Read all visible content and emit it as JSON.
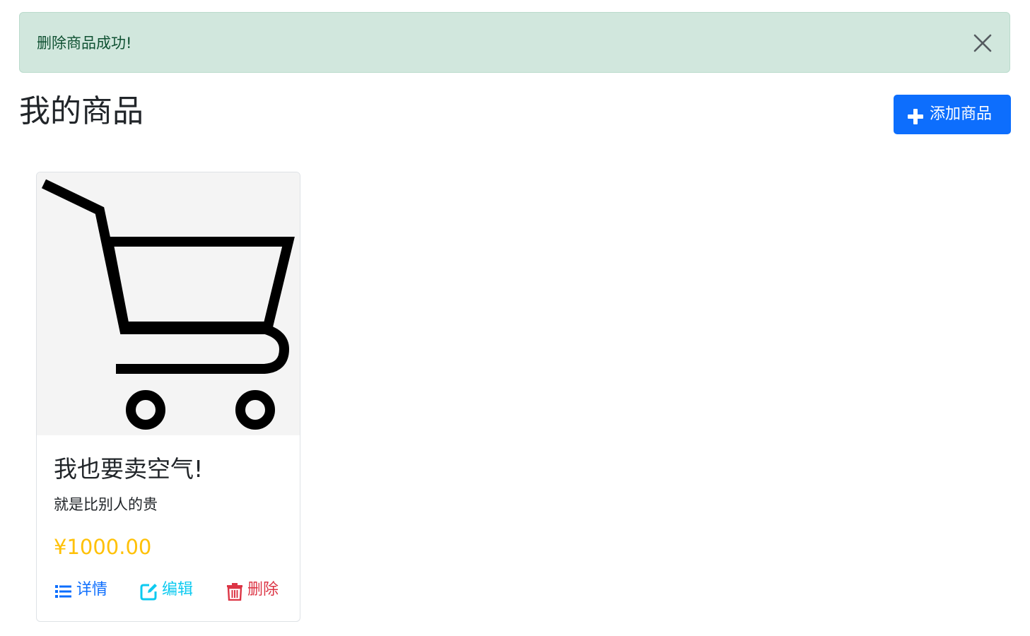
{
  "alert": {
    "message": "删除商品成功!",
    "close_icon": "close-icon",
    "color": "#d1e7dd"
  },
  "header": {
    "title": "我的商品",
    "add_button_label": "添加商品",
    "add_button_icon": "plus-icon",
    "accent_color": "#0d6efd"
  },
  "products": [
    {
      "image_icon": "shopping-cart-icon",
      "title": "我也要卖空气!",
      "description": "就是比别人的贵",
      "price": "¥1000.00",
      "actions": {
        "details_label": "详情",
        "details_icon": "list-icon",
        "edit_label": "编辑",
        "edit_icon": "edit-icon",
        "delete_label": "删除",
        "delete_icon": "trash-icon"
      }
    }
  ],
  "colors": {
    "price": "#ffc107",
    "details": "#0d6efd",
    "edit": "#0dcaf0",
    "delete": "#dc3545"
  }
}
